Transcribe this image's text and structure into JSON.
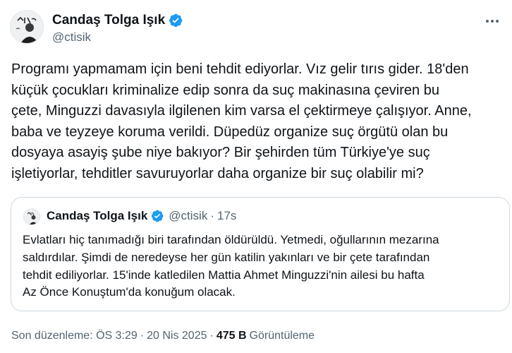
{
  "author": {
    "display_name": "Candaş Tolga Işık",
    "handle": "@ctisik"
  },
  "tweet": {
    "text": "Programı yapmamam için beni tehdit ediyorlar. Vız gelir tırıs gider. 18'den\nküçük çocukları kriminalize edip sonra da suç makinasına çeviren bu\nçete, Minguzzi davasıyla ilgilenen kim varsa el çektirmeye çalışıyor. Anne,\nbaba ve teyzeye koruma verildi. Düpedüz organize suç örgütü olan bu\ndosyaya asayiş şube niye bakıyor? Bir şehirden tüm Türkiye'ye suç\nişletiyorlar, tehditler savuruyorlar daha organize bir suç olabilir mi?"
  },
  "quote": {
    "display_name": "Candaş Tolga Işık",
    "handle": "@ctisik",
    "dot": "·",
    "time": "17s",
    "text": "Evlatları hiç tanımadığı biri tarafından öldürüldü. Yetmedi, oğullarının mezarına\nsaldırdılar. Şimdi de neredeyse her gün katilin yakınları ve bir çete tarafından\ntehdit ediliyorlar. 15'inde katledilen Mattia Ahmet Minguzzi'nin ailesi bu hafta\nAz Önce Konuştum'da konuğum olacak."
  },
  "meta": {
    "edited_label": "Son düzenleme: ÖS 3:29",
    "sep1": "·",
    "date": "20 Nis 2025",
    "sep2": "·",
    "views_count": "475 B",
    "views_label": "Görüntüleme"
  },
  "colors": {
    "verified": "#1d9bf0",
    "secondary_text": "#536471",
    "border": "#cfd9de"
  },
  "icons": {
    "verified": "verified-badge-icon",
    "more": "more-options-icon"
  }
}
